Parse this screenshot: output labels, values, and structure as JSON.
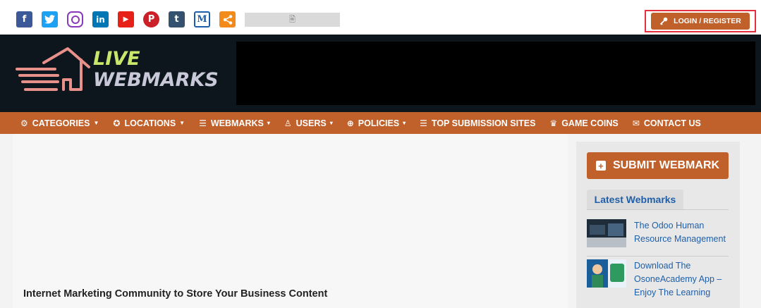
{
  "topbar": {
    "social": [
      {
        "name": "facebook-icon",
        "glyph": "f",
        "color": "#3b5998"
      },
      {
        "name": "twitter-icon",
        "glyph": "t",
        "color": "#1da1f2"
      },
      {
        "name": "instagram-icon",
        "glyph": "",
        "color": "#8a3ab9"
      },
      {
        "name": "linkedin-icon",
        "glyph": "in",
        "color": "#0077b5"
      },
      {
        "name": "youtube-icon",
        "glyph": "▶",
        "color": "#e62117"
      },
      {
        "name": "pinterest-icon",
        "glyph": "P",
        "color": "#cb2027"
      },
      {
        "name": "tumblr-icon",
        "glyph": "t",
        "color": "#34526f"
      },
      {
        "name": "medium-icon",
        "glyph": "M",
        "color": "#1c5ea8"
      },
      {
        "name": "share-icon",
        "glyph": "<",
        "color": "#f28b1c"
      }
    ],
    "image_placeholder_icon": "🖹",
    "login_label": "LOGIN / REGISTER"
  },
  "logo": {
    "line1": "LIVE",
    "line2": "WEBMARKS"
  },
  "nav": {
    "items": [
      {
        "icon": "⚙",
        "label": "CATEGORIES",
        "caret": "⌄"
      },
      {
        "icon": "✪",
        "label": "LOCATIONS",
        "caret": "⌄"
      },
      {
        "icon": "☰",
        "label": "WEBMARKS",
        "caret": "▾"
      },
      {
        "icon": "♙",
        "label": "USERS",
        "caret": "▾"
      },
      {
        "icon": "⊕",
        "label": "POLICIES",
        "caret": "▾"
      },
      {
        "icon": "☰",
        "label": "TOP SUBMISSION SITES",
        "caret": ""
      },
      {
        "icon": "♛",
        "label": "GAME COINS",
        "caret": ""
      },
      {
        "icon": "✉",
        "label": "CONTACT US",
        "caret": ""
      }
    ]
  },
  "main": {
    "tagline": "Internet Marketing Community to Store Your Business Content"
  },
  "sidebar": {
    "submit_label": "SUBMIT WEBMARK",
    "latest_title": "Latest Webmarks",
    "items": [
      {
        "title": "The Odoo Human Resource Management"
      },
      {
        "title": "Download The OsoneAcademy App – Enjoy The Learning"
      }
    ]
  },
  "colors": {
    "brand_orange": "#c0612c",
    "header_dark": "#0d161d",
    "link_blue": "#1e5fa8",
    "highlight_red": "#e5303f"
  }
}
